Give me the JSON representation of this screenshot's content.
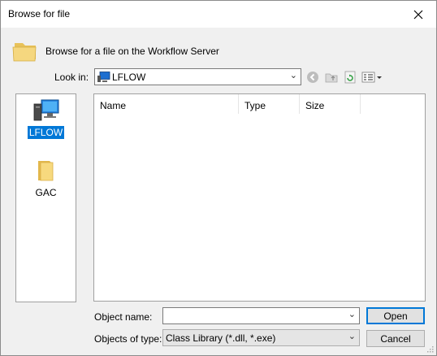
{
  "window": {
    "title": "Browse for file"
  },
  "header": {
    "text": "Browse for a file on the Workflow Server"
  },
  "lookin": {
    "label": "Look in:",
    "value": "LFLOW"
  },
  "places": [
    {
      "label": "LFLOW",
      "icon": "computer-icon",
      "selected": true
    },
    {
      "label": "GAC",
      "icon": "folder-icon",
      "selected": false
    }
  ],
  "columns": [
    "Name",
    "Type",
    "Size"
  ],
  "object_name": {
    "label": "Object name:",
    "value": ""
  },
  "object_type": {
    "label": "Objects of type:",
    "value": "Class Library (*.dll, *.exe)"
  },
  "buttons": {
    "open": "Open",
    "cancel": "Cancel"
  },
  "colors": {
    "accent": "#0078d7",
    "dialog_bg": "#f0f0f0"
  }
}
